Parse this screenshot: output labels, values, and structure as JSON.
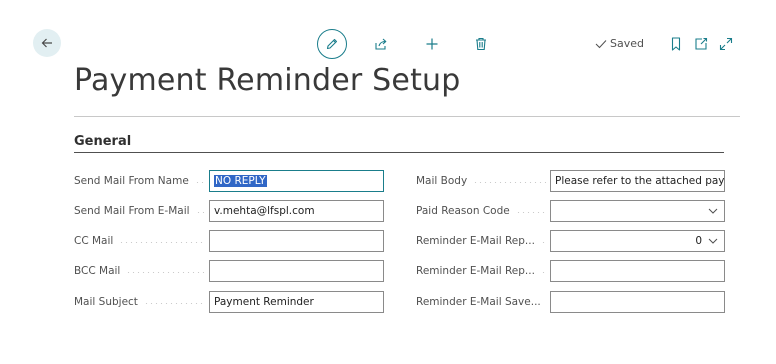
{
  "toolbar": {
    "saved_label": "Saved",
    "back_icon": "arrow-left-icon",
    "edit_icon": "pencil-icon",
    "share_icon": "share-icon",
    "new_icon": "plus-icon",
    "delete_icon": "trash-icon",
    "bookmark_icon": "bookmark-icon",
    "open_new_window_icon": "open-in-new-window-icon",
    "expand_icon": "expand-icon"
  },
  "page": {
    "title": "Payment Reminder Setup"
  },
  "section": {
    "title": "General"
  },
  "fields_left": [
    {
      "label": "Send Mail From Name",
      "value": "NO REPLY"
    },
    {
      "label": "Send Mail From E-Mail",
      "value": "v.mehta@lfspl.com"
    },
    {
      "label": "CC Mail",
      "value": ""
    },
    {
      "label": "BCC Mail",
      "value": ""
    },
    {
      "label": "Mail Subject",
      "value": "Payment Reminder"
    }
  ],
  "fields_right": [
    {
      "label": "Mail Body",
      "value": "Please refer to the attached paym"
    },
    {
      "label": "Paid Reason Code",
      "value": ""
    },
    {
      "label": "Reminder E-Mail Rep...",
      "value": "0"
    },
    {
      "label": "Reminder E-Mail Rep...",
      "value": ""
    },
    {
      "label": "Reminder E-Mail Save...",
      "value": ""
    }
  ],
  "colors": {
    "accent": "#1a7d8b",
    "selection": "#3167c6",
    "back_bg": "#e2eff2"
  }
}
